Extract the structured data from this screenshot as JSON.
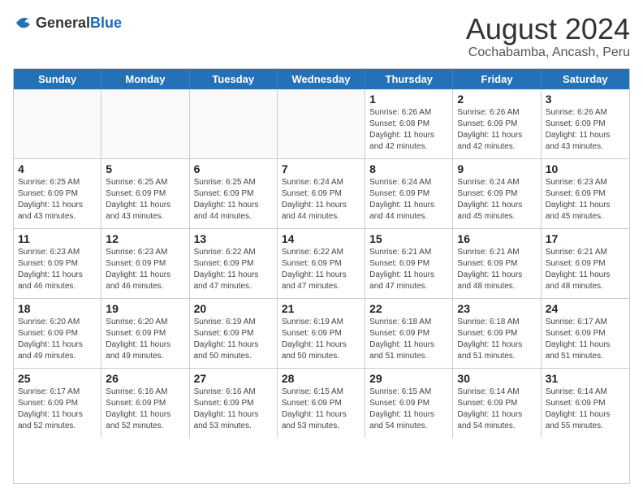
{
  "header": {
    "logo_general": "General",
    "logo_blue": "Blue",
    "month_title": "August 2024",
    "location": "Cochabamba, Ancash, Peru"
  },
  "day_headers": [
    "Sunday",
    "Monday",
    "Tuesday",
    "Wednesday",
    "Thursday",
    "Friday",
    "Saturday"
  ],
  "weeks": [
    [
      {
        "day": "",
        "info": "",
        "empty": true
      },
      {
        "day": "",
        "info": "",
        "empty": true
      },
      {
        "day": "",
        "info": "",
        "empty": true
      },
      {
        "day": "",
        "info": "",
        "empty": true
      },
      {
        "day": "1",
        "info": "Sunrise: 6:26 AM\nSunset: 6:08 PM\nDaylight: 11 hours\nand 42 minutes.",
        "empty": false
      },
      {
        "day": "2",
        "info": "Sunrise: 6:26 AM\nSunset: 6:09 PM\nDaylight: 11 hours\nand 42 minutes.",
        "empty": false
      },
      {
        "day": "3",
        "info": "Sunrise: 6:26 AM\nSunset: 6:09 PM\nDaylight: 11 hours\nand 43 minutes.",
        "empty": false
      }
    ],
    [
      {
        "day": "4",
        "info": "Sunrise: 6:25 AM\nSunset: 6:09 PM\nDaylight: 11 hours\nand 43 minutes.",
        "empty": false
      },
      {
        "day": "5",
        "info": "Sunrise: 6:25 AM\nSunset: 6:09 PM\nDaylight: 11 hours\nand 43 minutes.",
        "empty": false
      },
      {
        "day": "6",
        "info": "Sunrise: 6:25 AM\nSunset: 6:09 PM\nDaylight: 11 hours\nand 44 minutes.",
        "empty": false
      },
      {
        "day": "7",
        "info": "Sunrise: 6:24 AM\nSunset: 6:09 PM\nDaylight: 11 hours\nand 44 minutes.",
        "empty": false
      },
      {
        "day": "8",
        "info": "Sunrise: 6:24 AM\nSunset: 6:09 PM\nDaylight: 11 hours\nand 44 minutes.",
        "empty": false
      },
      {
        "day": "9",
        "info": "Sunrise: 6:24 AM\nSunset: 6:09 PM\nDaylight: 11 hours\nand 45 minutes.",
        "empty": false
      },
      {
        "day": "10",
        "info": "Sunrise: 6:23 AM\nSunset: 6:09 PM\nDaylight: 11 hours\nand 45 minutes.",
        "empty": false
      }
    ],
    [
      {
        "day": "11",
        "info": "Sunrise: 6:23 AM\nSunset: 6:09 PM\nDaylight: 11 hours\nand 46 minutes.",
        "empty": false
      },
      {
        "day": "12",
        "info": "Sunrise: 6:23 AM\nSunset: 6:09 PM\nDaylight: 11 hours\nand 46 minutes.",
        "empty": false
      },
      {
        "day": "13",
        "info": "Sunrise: 6:22 AM\nSunset: 6:09 PM\nDaylight: 11 hours\nand 47 minutes.",
        "empty": false
      },
      {
        "day": "14",
        "info": "Sunrise: 6:22 AM\nSunset: 6:09 PM\nDaylight: 11 hours\nand 47 minutes.",
        "empty": false
      },
      {
        "day": "15",
        "info": "Sunrise: 6:21 AM\nSunset: 6:09 PM\nDaylight: 11 hours\nand 47 minutes.",
        "empty": false
      },
      {
        "day": "16",
        "info": "Sunrise: 6:21 AM\nSunset: 6:09 PM\nDaylight: 11 hours\nand 48 minutes.",
        "empty": false
      },
      {
        "day": "17",
        "info": "Sunrise: 6:21 AM\nSunset: 6:09 PM\nDaylight: 11 hours\nand 48 minutes.",
        "empty": false
      }
    ],
    [
      {
        "day": "18",
        "info": "Sunrise: 6:20 AM\nSunset: 6:09 PM\nDaylight: 11 hours\nand 49 minutes.",
        "empty": false
      },
      {
        "day": "19",
        "info": "Sunrise: 6:20 AM\nSunset: 6:09 PM\nDaylight: 11 hours\nand 49 minutes.",
        "empty": false
      },
      {
        "day": "20",
        "info": "Sunrise: 6:19 AM\nSunset: 6:09 PM\nDaylight: 11 hours\nand 50 minutes.",
        "empty": false
      },
      {
        "day": "21",
        "info": "Sunrise: 6:19 AM\nSunset: 6:09 PM\nDaylight: 11 hours\nand 50 minutes.",
        "empty": false
      },
      {
        "day": "22",
        "info": "Sunrise: 6:18 AM\nSunset: 6:09 PM\nDaylight: 11 hours\nand 51 minutes.",
        "empty": false
      },
      {
        "day": "23",
        "info": "Sunrise: 6:18 AM\nSunset: 6:09 PM\nDaylight: 11 hours\nand 51 minutes.",
        "empty": false
      },
      {
        "day": "24",
        "info": "Sunrise: 6:17 AM\nSunset: 6:09 PM\nDaylight: 11 hours\nand 51 minutes.",
        "empty": false
      }
    ],
    [
      {
        "day": "25",
        "info": "Sunrise: 6:17 AM\nSunset: 6:09 PM\nDaylight: 11 hours\nand 52 minutes.",
        "empty": false
      },
      {
        "day": "26",
        "info": "Sunrise: 6:16 AM\nSunset: 6:09 PM\nDaylight: 11 hours\nand 52 minutes.",
        "empty": false
      },
      {
        "day": "27",
        "info": "Sunrise: 6:16 AM\nSunset: 6:09 PM\nDaylight: 11 hours\nand 53 minutes.",
        "empty": false
      },
      {
        "day": "28",
        "info": "Sunrise: 6:15 AM\nSunset: 6:09 PM\nDaylight: 11 hours\nand 53 minutes.",
        "empty": false
      },
      {
        "day": "29",
        "info": "Sunrise: 6:15 AM\nSunset: 6:09 PM\nDaylight: 11 hours\nand 54 minutes.",
        "empty": false
      },
      {
        "day": "30",
        "info": "Sunrise: 6:14 AM\nSunset: 6:09 PM\nDaylight: 11 hours\nand 54 minutes.",
        "empty": false
      },
      {
        "day": "31",
        "info": "Sunrise: 6:14 AM\nSunset: 6:09 PM\nDaylight: 11 hours\nand 55 minutes.",
        "empty": false
      }
    ]
  ]
}
